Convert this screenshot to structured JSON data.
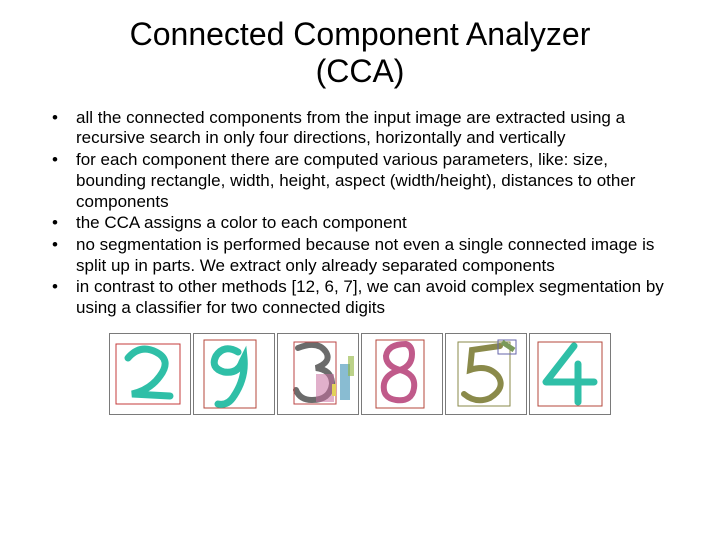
{
  "title_line1": "Connected Component Analyzer",
  "title_line2": "(CCA)",
  "bullets": [
    "all the connected components from the input image are extracted using a recursive search in only four directions, horizontally and vertically",
    "for each component there are computed various parameters, like: size, bounding rectangle, width, height, aspect (width/height), distances to other components",
    "the CCA assigns a color to each component",
    "no segmentation is performed because not even a single connected image is split up in parts. We extract only already separated components",
    "in contrast to other methods [12, 6, 7], we can avoid complex segmentation by using a classifier for two connected digits"
  ]
}
